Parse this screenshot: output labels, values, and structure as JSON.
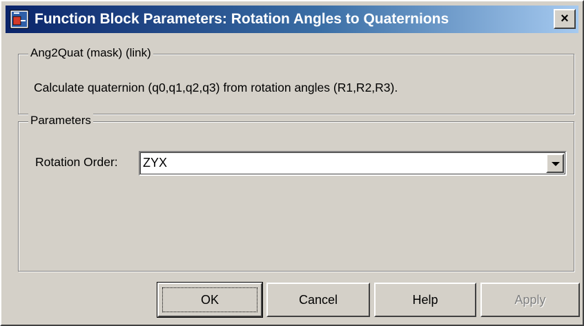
{
  "window": {
    "title": "Function Block Parameters: Rotation Angles to Quaternions",
    "close_label": "×"
  },
  "description_group": {
    "legend": "Ang2Quat (mask) (link)",
    "text": "Calculate quaternion (q0,q1,q2,q3) from rotation angles (R1,R2,R3)."
  },
  "parameters_group": {
    "legend": "Parameters",
    "rotation_order_label": "Rotation Order:",
    "rotation_order_value": "ZYX"
  },
  "buttons": {
    "ok": "OK",
    "cancel": "Cancel",
    "help": "Help",
    "apply": "Apply"
  },
  "colors": {
    "titlebar_start": "#0a246a",
    "titlebar_end": "#a6caf0",
    "face": "#d4d0c8"
  },
  "icons": {
    "app": "simulink-block-icon",
    "close": "close-icon",
    "dropdown": "chevron-down-icon"
  }
}
